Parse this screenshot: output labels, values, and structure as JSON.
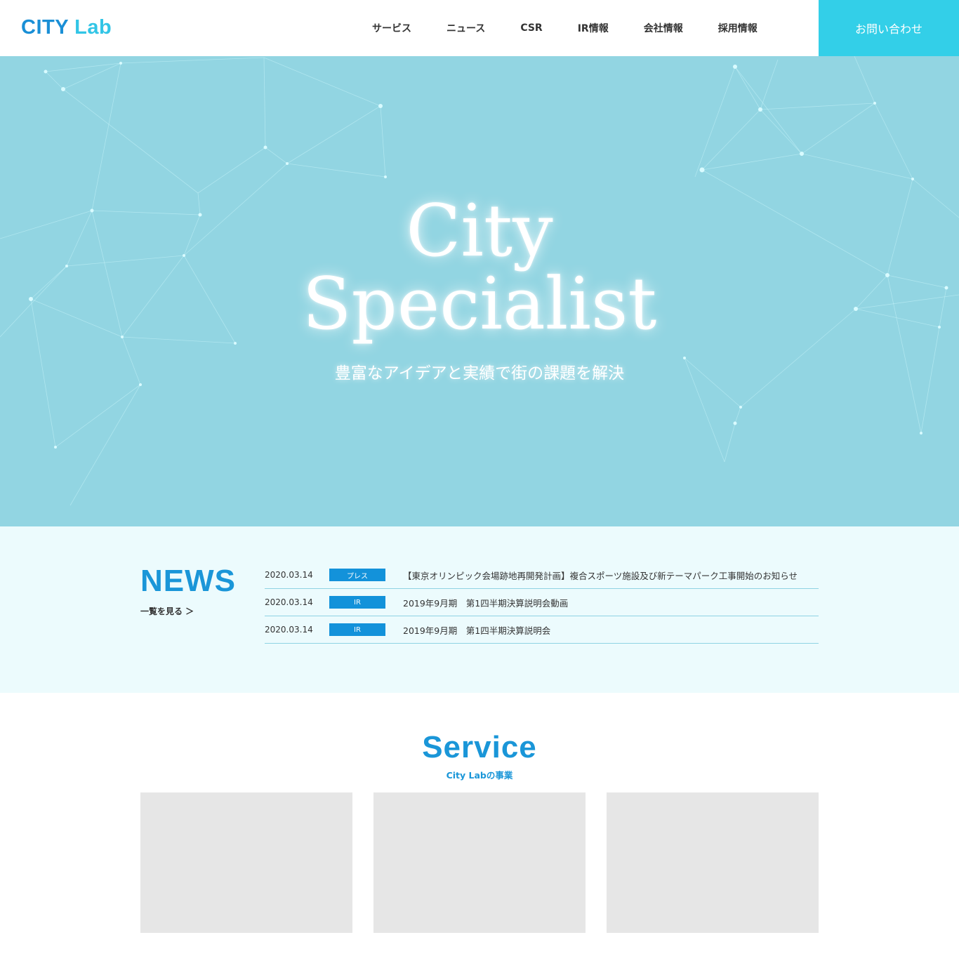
{
  "header": {
    "logo_part1": "CITY",
    "logo_part2": "Lab",
    "nav": [
      "サービス",
      "ニュース",
      "CSR",
      "IR情報",
      "会社情報",
      "採用情報"
    ],
    "contact_label": "お問い合わせ"
  },
  "hero": {
    "title_line1": "City",
    "title_line2": "Specialist",
    "subtitle": "豊富なアイデアと実績で街の課題を解決"
  },
  "news": {
    "heading": "NEWS",
    "more_label": "一覧を見る ＞",
    "items": [
      {
        "date": "2020.03.14",
        "tag": "プレス",
        "title": "【東京オリンピック会場跡地再開発計画】複合スポーツ施設及び新テーマパーク工事開始のお知らせ"
      },
      {
        "date": "2020.03.14",
        "tag": "IR",
        "title": "2019年9月期　第1四半期決算説明会動画"
      },
      {
        "date": "2020.03.14",
        "tag": "IR",
        "title": "2019年9月期　第1四半期決算説明会"
      }
    ]
  },
  "service": {
    "heading": "Service",
    "subheading": "City Labの事業"
  },
  "colors": {
    "brand_blue": "#1a96d8",
    "accent_cyan": "#33cfe8",
    "hero_bg": "#92d5e2",
    "news_bg": "#ecfbfd",
    "tag_bg": "#1392da"
  }
}
